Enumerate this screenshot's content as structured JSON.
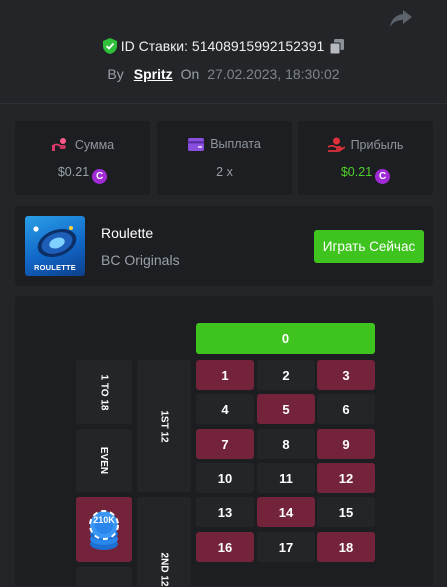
{
  "bet": {
    "id_label": "ID Ставки:",
    "id_value": "51408915992152391",
    "by_label": "By",
    "user": "Spritz",
    "on_label": "On",
    "datetime": "27.02.2023, 18:30:02"
  },
  "stats": {
    "amount": {
      "label": "Сумма",
      "value": "$0.21"
    },
    "payout": {
      "label": "Выплата",
      "value": "2 x"
    },
    "profit": {
      "label": "Прибыль",
      "value": "$0.21"
    }
  },
  "coin_symbol": "C",
  "game": {
    "name": "Roulette",
    "provider": "BC Originals",
    "thumb_label": "ROULETTE",
    "play_label": "Играть Сейчас"
  },
  "table": {
    "zero": "0",
    "outside": {
      "low": "1 TO 18",
      "even": "EVEN"
    },
    "dozens": {
      "first": "1ST 12",
      "second": "2ND 12"
    },
    "chip_label": "210K",
    "rows": [
      [
        {
          "n": "1",
          "c": "red"
        },
        {
          "n": "2",
          "c": "black"
        },
        {
          "n": "3",
          "c": "red"
        }
      ],
      [
        {
          "n": "4",
          "c": "black"
        },
        {
          "n": "5",
          "c": "red"
        },
        {
          "n": "6",
          "c": "black"
        }
      ],
      [
        {
          "n": "7",
          "c": "red"
        },
        {
          "n": "8",
          "c": "black"
        },
        {
          "n": "9",
          "c": "red"
        }
      ],
      [
        {
          "n": "10",
          "c": "black"
        },
        {
          "n": "11",
          "c": "black"
        },
        {
          "n": "12",
          "c": "red"
        }
      ],
      [
        {
          "n": "13",
          "c": "black"
        },
        {
          "n": "14",
          "c": "red"
        },
        {
          "n": "15",
          "c": "black"
        }
      ],
      [
        {
          "n": "16",
          "c": "red"
        },
        {
          "n": "17",
          "c": "black"
        },
        {
          "n": "18",
          "c": "red"
        }
      ]
    ]
  },
  "colors": {
    "background": "#232528",
    "card": "#1c1e21",
    "green": "#3fc41f",
    "red_cell": "#74243a",
    "coin": "#a02bd6",
    "profit_text": "#4fd12c"
  }
}
